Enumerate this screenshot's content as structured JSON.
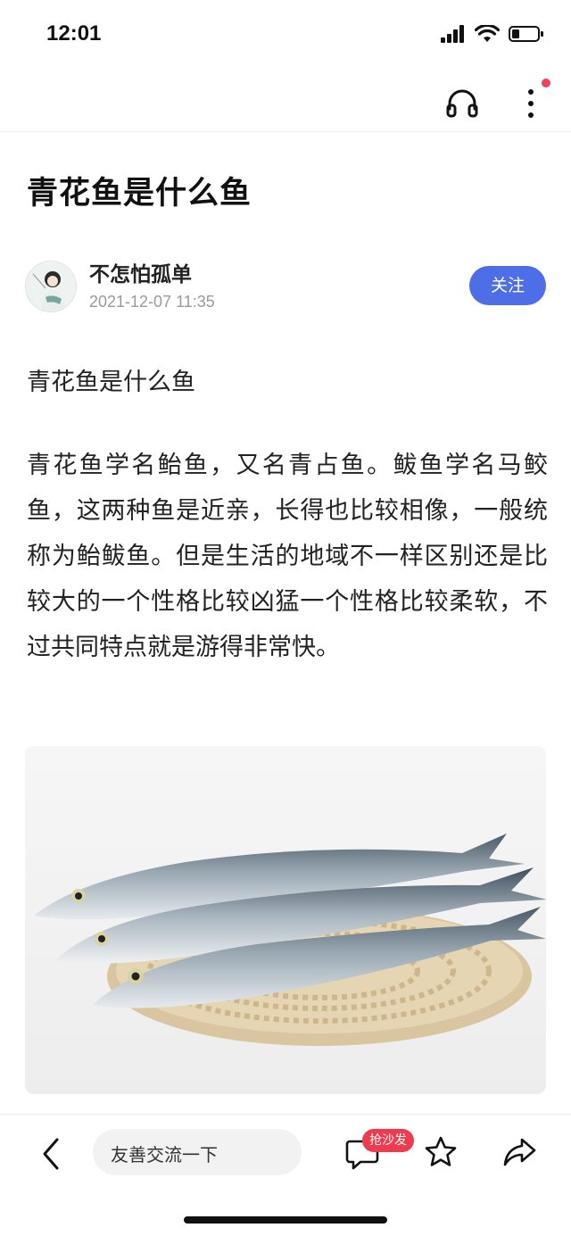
{
  "status_bar": {
    "time": "12:01"
  },
  "article": {
    "title": "青花鱼是什么鱼",
    "author": {
      "name": "不怎怕孤单",
      "time": "2021-12-07 11:35",
      "follow_label": "关注"
    },
    "heading": "青花鱼是什么鱼",
    "body": "青花鱼学名鲐鱼，又名青占鱼。鲅鱼学名马鲛鱼，这两种鱼是近亲，长得也比较相像，一般统称为鲐鲅鱼。但是生活的地域不一样区别还是比较大的一个性格比较凶猛一个性格比较柔软，不过共同特点就是游得非常快。"
  },
  "bottom_bar": {
    "comment_placeholder": "友善交流一下",
    "sofa_badge": "抢沙发"
  },
  "icons": {
    "headphone": "headphone-icon",
    "more": "more-vertical-icon",
    "back": "chevron-left-icon",
    "comment": "comment-icon",
    "star": "star-icon",
    "share": "share-icon"
  },
  "colors": {
    "accent": "#4d6ee6",
    "badge": "#ee3b4f"
  }
}
